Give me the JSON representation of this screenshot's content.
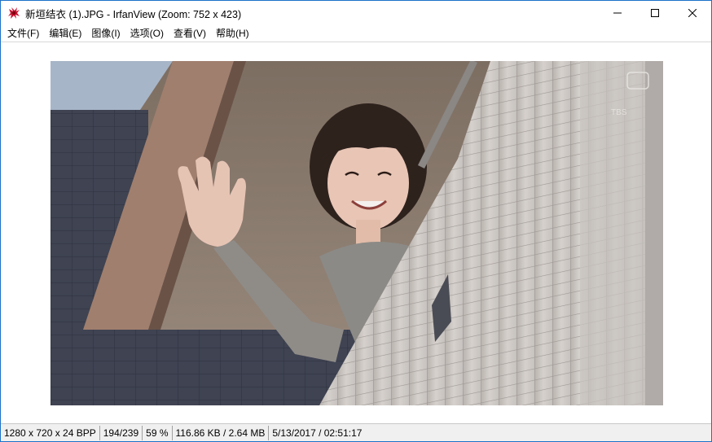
{
  "window": {
    "title": "新垣结衣 (1).JPG - IrfanView (Zoom: 752 x 423)",
    "controls": {
      "minimize": "minimize",
      "maximize": "maximize",
      "close": "close"
    }
  },
  "menu": {
    "items": [
      {
        "label": "文件(F)"
      },
      {
        "label": "编辑(E)"
      },
      {
        "label": "图像(I)"
      },
      {
        "label": "选项(O)"
      },
      {
        "label": "查看(V)"
      },
      {
        "label": "帮助(H)"
      }
    ]
  },
  "image": {
    "watermark": "TBS",
    "content": "photo"
  },
  "status": {
    "dimensions": "1280 x 720 x 24 BPP",
    "index": "194/239",
    "zoom": "59 %",
    "size": "116.86 KB / 2.64 MB",
    "datetime": "5/13/2017 / 02:51:17"
  },
  "colors": {
    "title_bar": "#ffffff",
    "window_border": "#1b73c9",
    "status_bar": "#f0f0f0",
    "app_icon_red": "#c8102e"
  }
}
